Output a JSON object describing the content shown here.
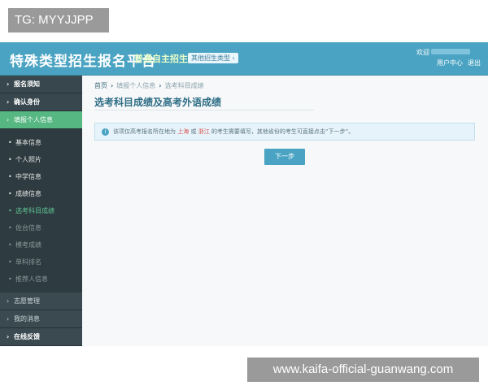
{
  "overlay_tag": "TG: MYYJJPP",
  "header": {
    "title": "特殊类型招生报名平台",
    "subtitle": "普通自主招生",
    "other_types_button": "其他招生类型 ›",
    "welcome": "欢迎",
    "user_center": "用户中心",
    "logout": "退出"
  },
  "sidebar": {
    "top_items": [
      {
        "label": "报名须知"
      },
      {
        "label": "确认身份"
      }
    ],
    "active_group": "填报个人信息",
    "sub_items": [
      {
        "label": "基本信息"
      },
      {
        "label": "个人照片"
      },
      {
        "label": "中学信息"
      },
      {
        "label": "成绩信息"
      },
      {
        "label": "选考科目成绩"
      },
      {
        "label": "佐台信息"
      },
      {
        "label": "模考成绩"
      },
      {
        "label": "单科排名"
      },
      {
        "label": "推荐人信息"
      }
    ],
    "bottom_items": [
      {
        "label": "志愿管理"
      },
      {
        "label": "我的消息"
      },
      {
        "label": "在线反馈"
      }
    ]
  },
  "breadcrumb": [
    "首页",
    "填报个人信息",
    "选考科目成绩"
  ],
  "page_title": "选考科目成绩及高考外语成绩",
  "info": {
    "prefix": "该项仅高考报名所在地为",
    "highlight1": "上海",
    "or": "或",
    "highlight2": "浙江",
    "suffix": "的考生需要填写，其他省份的考生可直接点击“下一步”。"
  },
  "next_button": "下一步",
  "watermark": "www.kaifa-official-guanwang.com"
}
